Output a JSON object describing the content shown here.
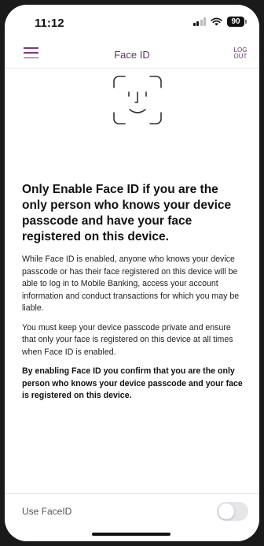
{
  "status_bar": {
    "time": "11:12",
    "battery": "90"
  },
  "nav": {
    "title": "Face ID",
    "logout_line1": "LOG",
    "logout_line2": "OUT"
  },
  "content": {
    "heading": "Only Enable Face ID if you are the only person who knows your device passcode and have your face registered on this device.",
    "paragraph1": "While Face ID is enabled, anyone who knows your device passcode or has their face registered on this device will be able to log in to Mobile Banking, access your account information and conduct transactions for which you may be liable.",
    "paragraph2": "You must keep your device passcode private and ensure that only your face is registered on this device at all times when Face ID is enabled.",
    "paragraph3": "By enabling Face ID you confirm that you are the only person who knows your device passcode and your face is registered on this device."
  },
  "toggle": {
    "label": "Use FaceID",
    "enabled": false
  },
  "colors": {
    "accent": "#6a2e72",
    "toggle_off": "#e6e6ea"
  },
  "icons": {
    "menu": "hamburger-menu-icon",
    "face": "face-id-icon"
  }
}
